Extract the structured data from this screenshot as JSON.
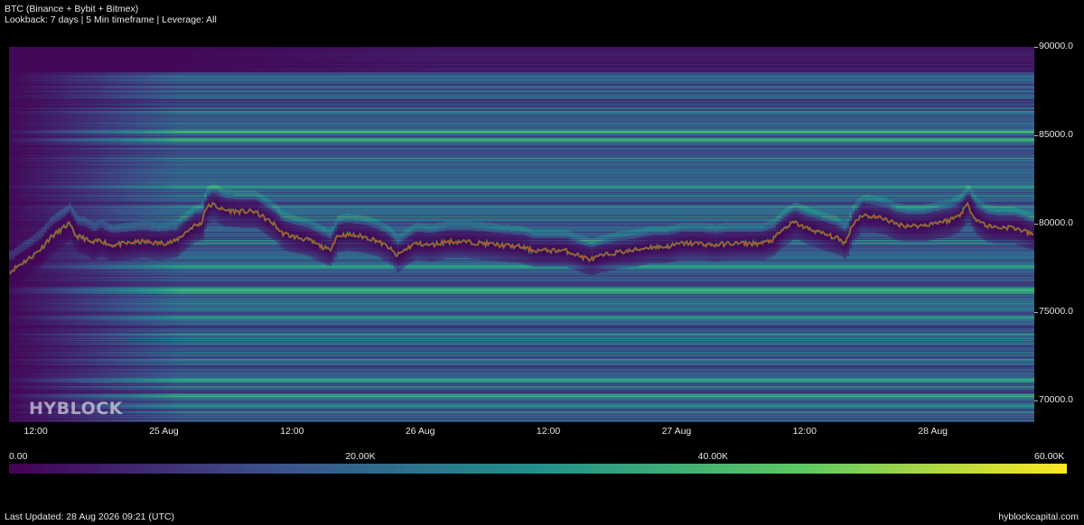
{
  "header": {
    "title": "BTC (Binance + Bybit + Bitmex)",
    "subtitle": "Lookback: 7 days | 5 Min timeframe | Leverage: All"
  },
  "watermark": "HYBLOCK",
  "footer": {
    "updated": "Last Updated: 28 Aug 2026 09:21 (UTC)",
    "site": "hyblockcapital.com"
  },
  "chart_data": {
    "type": "heatmap",
    "title": "BTC (Binance + Bybit + Bitmex)",
    "xlabel": "",
    "ylabel": "",
    "x_ticks": [
      {
        "label": "12:00",
        "hours": 12
      },
      {
        "label": "25 Aug",
        "hours": 24
      },
      {
        "label": "12:00",
        "hours": 36
      },
      {
        "label": "26 Aug",
        "hours": 48
      },
      {
        "label": "12:00",
        "hours": 60
      },
      {
        "label": "27 Aug",
        "hours": 72
      },
      {
        "label": "12:00",
        "hours": 84
      },
      {
        "label": "28 Aug",
        "hours": 96
      }
    ],
    "x_range_hours": [
      9.5,
      105.5
    ],
    "y_ticks": [
      90000,
      85000,
      80000,
      75000,
      70000
    ],
    "y_tick_labels": [
      "90000.0",
      "85000.0",
      "80000.0",
      "75000.0",
      "70000.0"
    ],
    "ylim": [
      68800,
      90000
    ],
    "colorbar": {
      "min": 0,
      "max": 60000,
      "tick_values": [
        0,
        20000,
        40000,
        60000
      ],
      "tick_labels": [
        "0.00",
        "20.00K",
        "40.00K",
        "60.00K"
      ],
      "colormap": "viridis"
    },
    "price_series": [
      [
        9.6,
        77300
      ],
      [
        10.5,
        77700
      ],
      [
        11.5,
        78100
      ],
      [
        12.5,
        78600
      ],
      [
        13.3,
        79200
      ],
      [
        14.2,
        79600
      ],
      [
        15.1,
        80000
      ],
      [
        15.8,
        79300
      ],
      [
        16.5,
        79200
      ],
      [
        17.3,
        78900
      ],
      [
        18.0,
        79100
      ],
      [
        19.0,
        78800
      ],
      [
        20.5,
        78900
      ],
      [
        22.0,
        79000
      ],
      [
        23.5,
        78900
      ],
      [
        25.0,
        79000
      ],
      [
        26.0,
        79500
      ],
      [
        26.8,
        79900
      ],
      [
        27.5,
        80000
      ],
      [
        27.9,
        80900
      ],
      [
        28.6,
        81100
      ],
      [
        29.5,
        80800
      ],
      [
        31.0,
        80700
      ],
      [
        32.5,
        80700
      ],
      [
        33.5,
        80300
      ],
      [
        34.3,
        80000
      ],
      [
        35.0,
        79500
      ],
      [
        36.0,
        79300
      ],
      [
        37.5,
        79100
      ],
      [
        38.5,
        78800
      ],
      [
        39.5,
        78500
      ],
      [
        40.2,
        79300
      ],
      [
        41.0,
        79400
      ],
      [
        42.5,
        79300
      ],
      [
        43.8,
        79100
      ],
      [
        45.0,
        78700
      ],
      [
        45.8,
        78200
      ],
      [
        46.5,
        78500
      ],
      [
        47.5,
        78900
      ],
      [
        49.0,
        78800
      ],
      [
        50.5,
        79000
      ],
      [
        52.0,
        79000
      ],
      [
        54.0,
        78900
      ],
      [
        55.5,
        78800
      ],
      [
        57.5,
        78700
      ],
      [
        58.5,
        78500
      ],
      [
        60.0,
        78500
      ],
      [
        61.5,
        78500
      ],
      [
        62.5,
        78300
      ],
      [
        63.3,
        78100
      ],
      [
        64.0,
        78000
      ],
      [
        65.0,
        78200
      ],
      [
        66.5,
        78400
      ],
      [
        68.0,
        78500
      ],
      [
        69.5,
        78700
      ],
      [
        71.0,
        78700
      ],
      [
        72.5,
        78900
      ],
      [
        74.0,
        78900
      ],
      [
        75.5,
        78800
      ],
      [
        77.0,
        78900
      ],
      [
        78.5,
        78900
      ],
      [
        80.0,
        78900
      ],
      [
        81.0,
        79100
      ],
      [
        82.0,
        79700
      ],
      [
        83.0,
        80100
      ],
      [
        84.0,
        79800
      ],
      [
        85.0,
        79600
      ],
      [
        86.0,
        79400
      ],
      [
        87.0,
        79200
      ],
      [
        87.8,
        78900
      ],
      [
        88.4,
        79900
      ],
      [
        89.3,
        80500
      ],
      [
        90.5,
        80400
      ],
      [
        91.5,
        80300
      ],
      [
        92.5,
        80000
      ],
      [
        93.5,
        79900
      ],
      [
        95.0,
        79900
      ],
      [
        96.5,
        80100
      ],
      [
        97.5,
        80200
      ],
      [
        98.5,
        80500
      ],
      [
        99.2,
        81100
      ],
      [
        100.0,
        80300
      ],
      [
        101.0,
        79900
      ],
      [
        102.0,
        79800
      ],
      [
        103.5,
        79800
      ],
      [
        104.5,
        79600
      ],
      [
        105.3,
        79400
      ]
    ]
  }
}
